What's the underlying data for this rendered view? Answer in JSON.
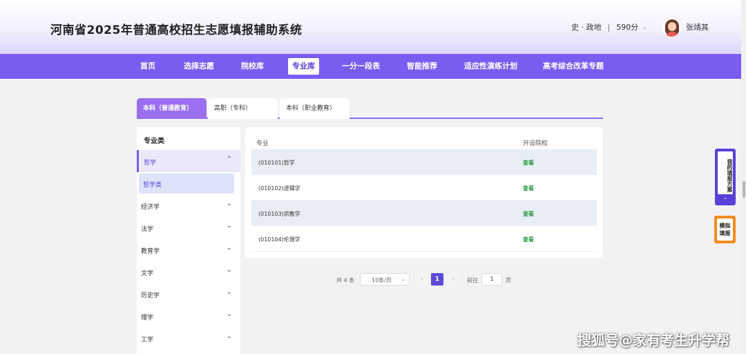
{
  "header": {
    "title": "河南省2025年普通高校招生志愿填报辅助系统",
    "subjects": "史 · 政地",
    "separator": "|",
    "score": "590分",
    "user_name": "张靖其"
  },
  "nav": {
    "items": [
      "首页",
      "选择志愿",
      "院校库",
      "专业库",
      "一分一段表",
      "智能推荐",
      "适应性演练计划",
      "高考综合改革专题"
    ],
    "active_index": 3
  },
  "category_tabs": [
    "本科（普通教育）",
    "高职（专科）",
    "本科（职业教育）"
  ],
  "sidebar": {
    "heading": "专业类",
    "open_item": "哲学",
    "sub_item": "哲学类",
    "items": [
      "经济学",
      "法学",
      "教育学",
      "文学",
      "历史学",
      "理学",
      "工学"
    ]
  },
  "table": {
    "col_major": "专业",
    "col_school": "开设院校",
    "rows": [
      {
        "major": "(010101)哲学",
        "action": "查看"
      },
      {
        "major": "(010102)逻辑学",
        "action": "查看"
      },
      {
        "major": "(010103)宗教学",
        "action": "查看"
      },
      {
        "major": "(010104)伦理学",
        "action": "查看"
      }
    ]
  },
  "pagination": {
    "total": "共 4 条",
    "page_size": "10条/页",
    "current_page": "1",
    "goto_label": "前往",
    "goto_value": "1",
    "page_suffix": "页"
  },
  "floating": {
    "plan_label": "我的填报方案",
    "sim_label_1": "模拟",
    "sim_label_2": "填报"
  },
  "watermark": "搜狐号@家有考生升学帮",
  "colors": {
    "primary": "#7b5cf0",
    "accent_orange": "#f58b1f",
    "link_green": "#2e9b47"
  }
}
